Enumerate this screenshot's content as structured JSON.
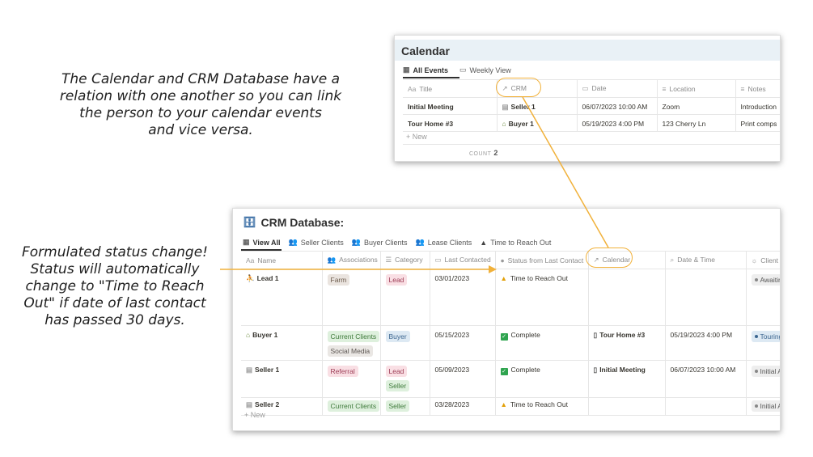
{
  "annotations": {
    "top_lines": [
      "The Calendar and CRM Database have a",
      "relation with one another so you can link",
      "the person to your calendar events",
      "and vice versa."
    ],
    "left_lines": [
      "Formulated status change!",
      "Status will automatically",
      "change to \"Time to Reach",
      "Out\" if date of last contact",
      "has passed 30 days."
    ]
  },
  "calendar": {
    "title": "Calendar",
    "tabs": [
      {
        "label": "All Events",
        "icon": "table-icon"
      },
      {
        "label": "Weekly View",
        "icon": "calendar-icon"
      }
    ],
    "columns": [
      {
        "label": "Title",
        "icon": "Aa"
      },
      {
        "label": "CRM",
        "icon": "↗"
      },
      {
        "label": "Date",
        "icon": "▭"
      },
      {
        "label": "Location",
        "icon": "≡"
      },
      {
        "label": "Notes",
        "icon": "≡"
      }
    ],
    "rows": [
      {
        "title": "Initial Meeting",
        "crm": "Seller 1",
        "date": "06/07/2023 10:00 AM",
        "location": "Zoom",
        "notes": "Introduction"
      },
      {
        "title": "Tour Home #3",
        "crm": "Buyer 1",
        "date": "05/19/2023 4:00 PM",
        "location": "123 Cherry Ln",
        "notes": "Print comps"
      }
    ],
    "new_label": "New",
    "count_label": "COUNT",
    "count_value": "2"
  },
  "crm": {
    "title": "CRM Database:",
    "tabs": [
      {
        "label": "View All",
        "icon": "table-icon"
      },
      {
        "label": "Seller Clients",
        "icon": "people-icon"
      },
      {
        "label": "Buyer Clients",
        "icon": "people-icon"
      },
      {
        "label": "Lease Clients",
        "icon": "people-icon"
      },
      {
        "label": "Time to Reach Out",
        "icon": "warning-icon"
      }
    ],
    "columns": [
      {
        "label": "Name",
        "icon": "Aa"
      },
      {
        "label": "Associations",
        "icon": "👥"
      },
      {
        "label": "Category",
        "icon": "☰"
      },
      {
        "label": "Last Contacted",
        "icon": "▭"
      },
      {
        "label": "Status from Last Contact",
        "icon": "●"
      },
      {
        "label": "Calendar",
        "icon": "↗"
      },
      {
        "label": "Date & Time",
        "icon": "⌕"
      },
      {
        "label": "Client S",
        "icon": "☼"
      }
    ],
    "rows": [
      {
        "name": "Lead 1",
        "associations": [
          "Farm"
        ],
        "categories": [
          "Lead"
        ],
        "last_contacted": "03/01/2023",
        "status": "Time to Reach Out",
        "status_kind": "warn",
        "calendar": "",
        "date_time": "",
        "client_status": "Awaitin"
      },
      {
        "name": "Buyer 1",
        "associations": [
          "Current Clients",
          "Social Media"
        ],
        "categories": [
          "Buyer"
        ],
        "last_contacted": "05/15/2023",
        "status": "Complete",
        "status_kind": "check",
        "calendar": "Tour Home #3",
        "date_time": "05/19/2023 4:00 PM",
        "client_status": "Touring"
      },
      {
        "name": "Seller 1",
        "associations": [
          "Referral"
        ],
        "categories": [
          "Lead",
          "Seller"
        ],
        "last_contacted": "05/09/2023",
        "status": "Complete",
        "status_kind": "check",
        "calendar": "Initial Meeting",
        "date_time": "06/07/2023 10:00 AM",
        "client_status": "Initial A"
      },
      {
        "name": "Seller 2",
        "associations": [
          "Current Clients"
        ],
        "categories": [
          "Seller"
        ],
        "last_contacted": "03/28/2023",
        "status": "Time to Reach Out",
        "status_kind": "warn",
        "calendar": "",
        "date_time": "",
        "client_status": "Initial A"
      }
    ],
    "new_label": "New"
  },
  "colors": {
    "accent_orange": "#f1b13a",
    "header_bg": "#e9f1f6"
  }
}
